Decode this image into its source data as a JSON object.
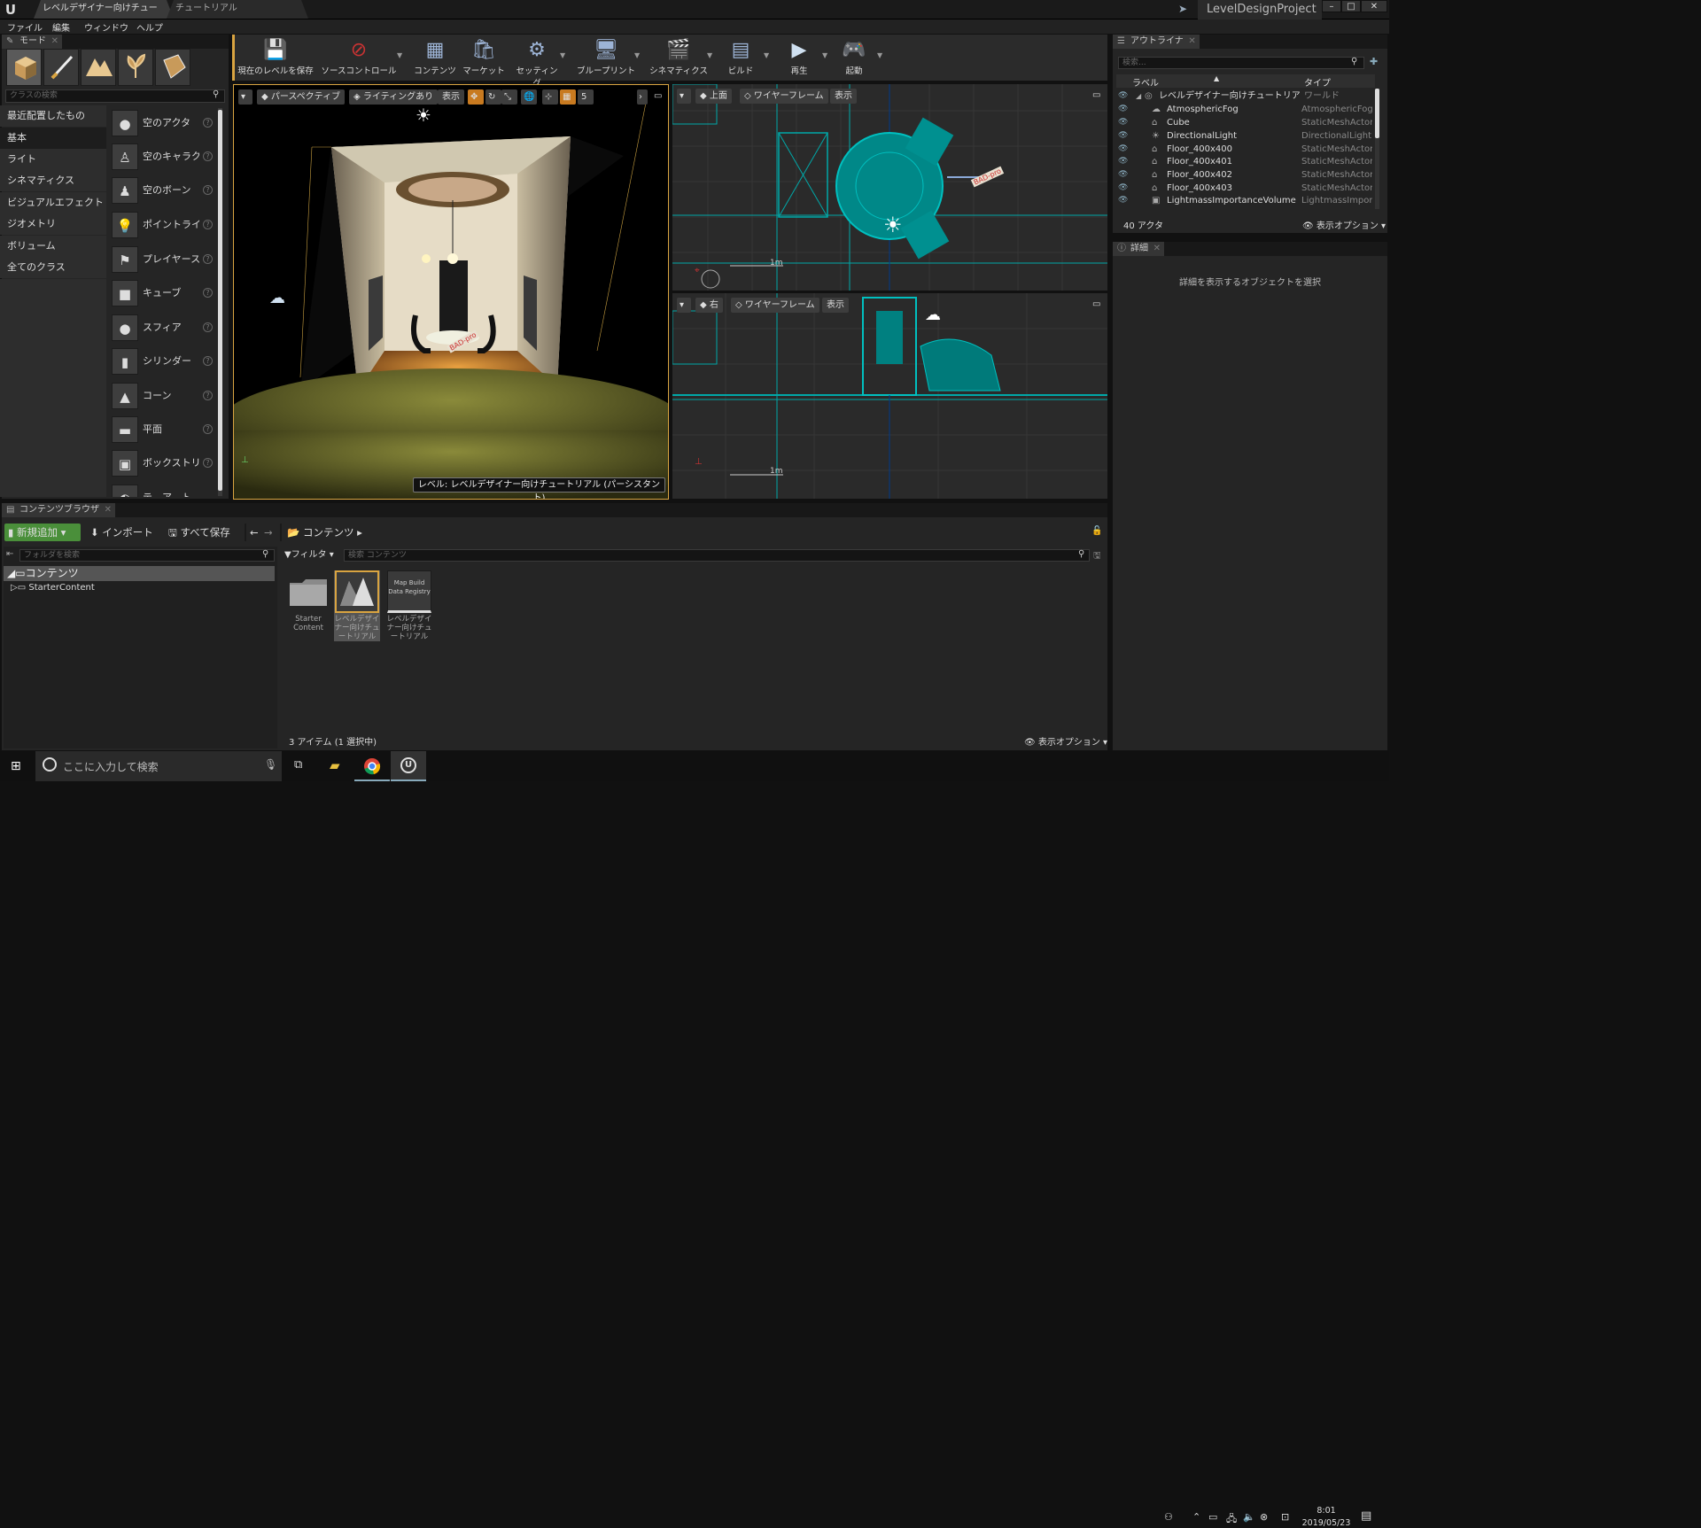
{
  "titlebar": {
    "tabs": [
      "レベルデザイナー向けチュート",
      "チュートリアル"
    ],
    "project": "LevelDesignProject",
    "controls": [
      "–",
      "□",
      "✕"
    ]
  },
  "menu": [
    "ファイル",
    "編集",
    "ウィンドウ",
    "ヘルプ"
  ],
  "modes": {
    "tab": "モード",
    "search_placeholder": "クラスの検索",
    "categories": [
      "最近配置したもの",
      "基本",
      "ライト",
      "シネマティクス",
      "ビジュアルエフェクト",
      "ジオメトリ",
      "ボリューム",
      "全てのクラス"
    ],
    "active_category": "基本",
    "items": [
      "空のアクタ",
      "空のキャラク",
      "空のボーン",
      "ポイントライト",
      "プレイヤース",
      "キューブ",
      "スフィア",
      "シリンダー",
      "コーン",
      "平面",
      "ボックストリ",
      "テ…ア…ト"
    ]
  },
  "toolbar": {
    "buttons": [
      "現在のレベルを保存",
      "ソースコントロール",
      "コンテンツ",
      "マーケット",
      "セッティング",
      "ブループリント",
      "シネマティクス",
      "ビルド",
      "再生",
      "起動"
    ]
  },
  "viewports": {
    "perspective": {
      "mode_label": "パースペクティブ",
      "lighting_label": "ライティングあり",
      "show_label": "表示",
      "grid_value": "5",
      "level_label": "レベル: レベルデザイナー向けチュートリアル (パーシスタント)"
    },
    "top": {
      "mode_label": "上面",
      "view_label": "ワイヤーフレーム",
      "show_label": "表示",
      "scale": "1m"
    },
    "right": {
      "mode_label": "右",
      "view_label": "ワイヤーフレーム",
      "show_label": "表示",
      "scale": "1m"
    },
    "decal": "BAD-pro"
  },
  "outliner": {
    "tab": "アウトライナ",
    "search_placeholder": "検索...",
    "col_label": "ラベル",
    "col_type": "タイプ",
    "root": {
      "name": "レベルデザイナー向けチュートリアル (",
      "type": "ワールド"
    },
    "rows": [
      {
        "name": "AtmosphericFog",
        "type": "AtmosphericFog"
      },
      {
        "name": "Cube",
        "type": "StaticMeshActor"
      },
      {
        "name": "DirectionalLight",
        "type": "DirectionalLight"
      },
      {
        "name": "Floor_400x400",
        "type": "StaticMeshActor"
      },
      {
        "name": "Floor_400x401",
        "type": "StaticMeshActor"
      },
      {
        "name": "Floor_400x402",
        "type": "StaticMeshActor"
      },
      {
        "name": "Floor_400x403",
        "type": "StaticMeshActor"
      },
      {
        "name": "LightmassImportanceVolume",
        "type": "LightmassImporta"
      }
    ],
    "count": "40 アクタ",
    "view_options": "表示オプション"
  },
  "details": {
    "tab": "詳細",
    "hint": "詳細を表示するオブジェクトを選択"
  },
  "content_browser": {
    "tab": "コンテンツブラウザ",
    "add_new": "新規追加",
    "import": "インポート",
    "save_all": "すべて保存",
    "path": "コンテンツ",
    "folder_search": "フォルダを検索",
    "tree": [
      "コンテンツ",
      "StarterContent"
    ],
    "filter": "フィルタ",
    "search_placeholder": "検索 コンテンツ",
    "assets": [
      {
        "name": "Starter Content"
      },
      {
        "name": "レベルデザイナー向けチュートリアル"
      },
      {
        "name": "レベルデザイナー向けチュートリアル",
        "thumb_text": "Map Build Data Registry"
      }
    ],
    "status": "3 アイテム (1 選択中)",
    "view_options": "表示オプション"
  },
  "taskbar": {
    "search_placeholder": "ここに入力して検索",
    "time": "8:01",
    "date": "2019/05/23"
  },
  "colors": {
    "accent_green": "#4a8f3a",
    "wire_cyan": "#00a8a8",
    "selection_orange": "#d9a441"
  }
}
